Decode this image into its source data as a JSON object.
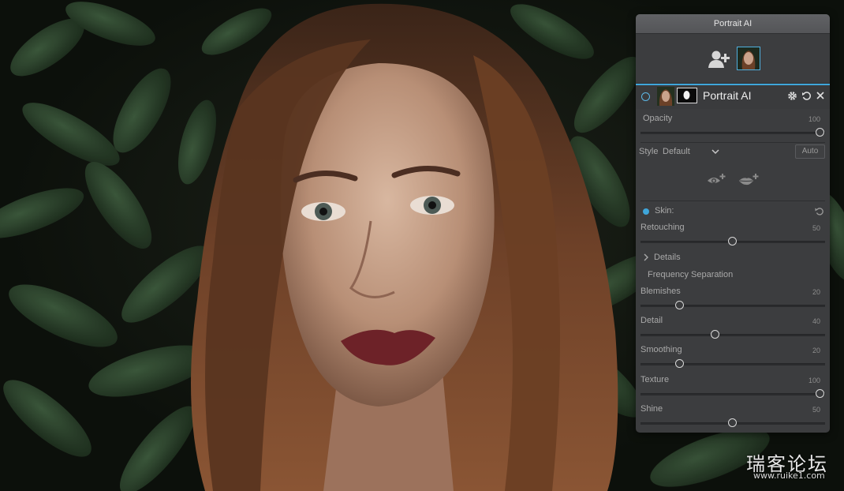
{
  "panel": {
    "title": "Portrait AI",
    "layer_name": "Portrait AI",
    "opacity": {
      "label": "Opacity",
      "value": "100",
      "level": 100
    },
    "style": {
      "label": "Style",
      "value": "Default",
      "auto_label": "Auto"
    },
    "skin": {
      "label": "Skin:",
      "retouching": {
        "label": "Retouching",
        "value": "50",
        "level": 50
      },
      "details_label": "Details",
      "freq_sep_label": "Frequency Separation",
      "sliders": [
        {
          "label": "Blemishes",
          "value": "20",
          "level": 20
        },
        {
          "label": "Detail",
          "value": "40",
          "level": 40
        },
        {
          "label": "Smoothing",
          "value": "20",
          "level": 20
        },
        {
          "label": "Texture",
          "value": "100",
          "level": 100
        },
        {
          "label": "Shine",
          "value": "50",
          "level": 50
        }
      ]
    }
  },
  "watermark": {
    "line1": "瑞客论坛",
    "line2": "www.ruike1.com"
  },
  "colors": {
    "accent": "#3fa6da",
    "panel_bg": "#3c3d3f",
    "title_bar": "#58595c"
  }
}
